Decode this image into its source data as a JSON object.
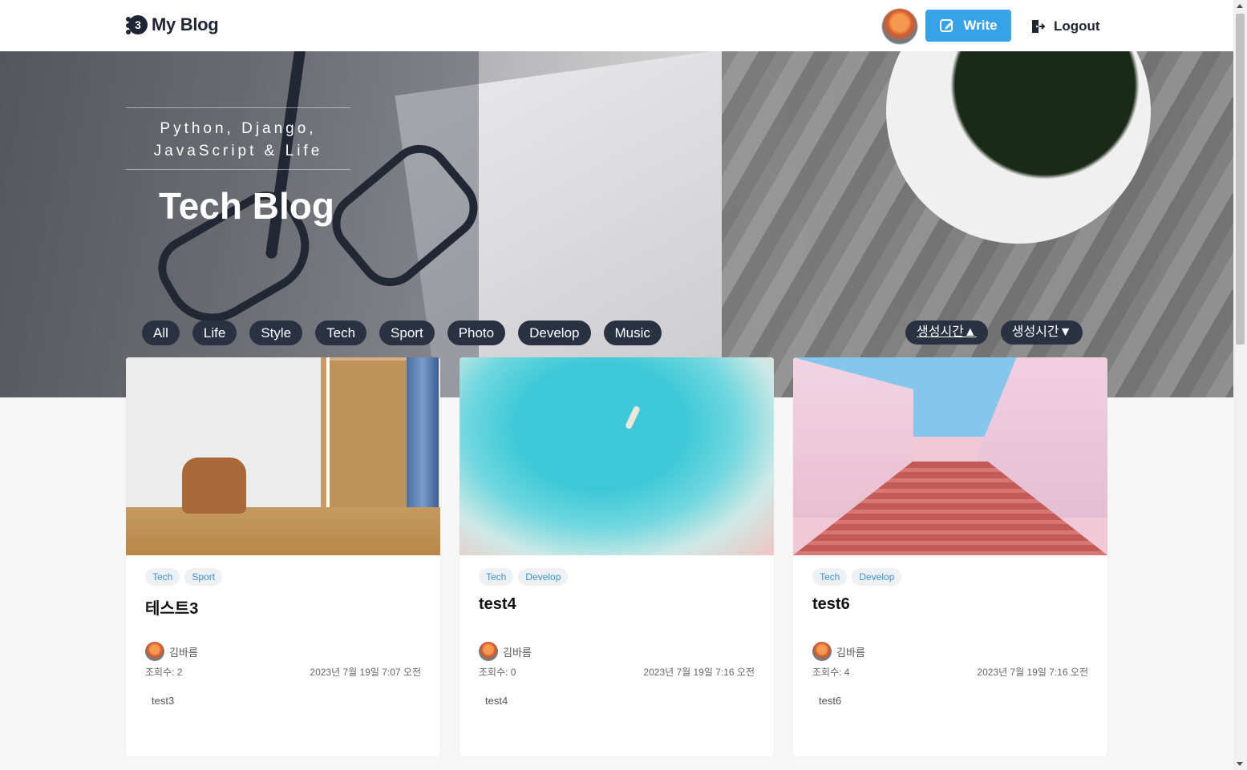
{
  "header": {
    "logo_text": "My Blog",
    "write_label": "Write",
    "logout_label": "Logout"
  },
  "hero": {
    "tagline_line1": "Python, Django,",
    "tagline_line2": "JavaScript & Life",
    "title": "Tech Blog"
  },
  "categories": [
    "All",
    "Life",
    "Style",
    "Tech",
    "Sport",
    "Photo",
    "Develop",
    "Music"
  ],
  "sort": {
    "asc_label": "생성시간▲",
    "desc_label": "생성시간▼"
  },
  "posts": [
    {
      "tags": [
        "Tech",
        "Sport"
      ],
      "title": "테스트3",
      "author": "김바름",
      "views": "조회수: 2",
      "date": "2023년 7월 19일 7:07 오전",
      "excerpt": "test3"
    },
    {
      "tags": [
        "Tech",
        "Develop"
      ],
      "title": "test4",
      "author": "김바름",
      "views": "조회수: 0",
      "date": "2023년 7월 19일 7:16 오전",
      "excerpt": "test4"
    },
    {
      "tags": [
        "Tech",
        "Develop"
      ],
      "title": "test6",
      "author": "김바름",
      "views": "조회수: 4",
      "date": "2023년 7월 19일 7:16 오전",
      "excerpt": "test6"
    }
  ],
  "colors": {
    "accent": "#36a3e8",
    "pill_bg": "#2a3142",
    "tag_text": "#3e8fd0"
  }
}
